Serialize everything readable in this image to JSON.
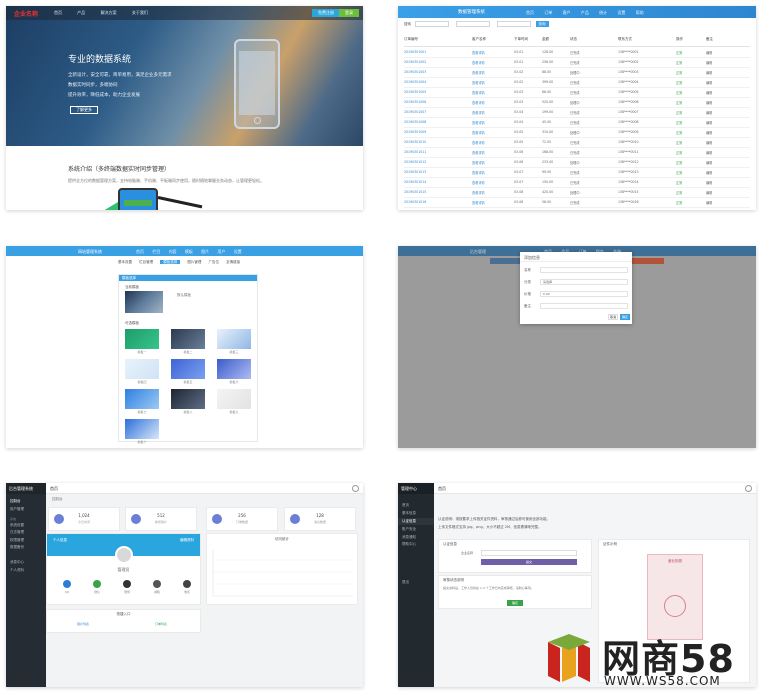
{
  "card1": {
    "logo": "企业名称",
    "menu": [
      "首页",
      "产品",
      "解决方案",
      "关于我们"
    ],
    "btn_register": "免费注册",
    "btn_login": "登录",
    "hero_title": "专业的数据系统",
    "hero_lines": [
      "全新设计，安全可靠，简单易用，满足企业多元需求",
      "数据实时同步，多端协同",
      "提升效率，降低成本，助力企业发展"
    ],
    "more_label": "了解更多",
    "section_title": "系统介绍（多终端数据实时同步管理）",
    "section_desc": "提供全方位的数据管理方案，支持电脑端、手机端、平板端同步使用，随时随地掌握业务动态，让管理更轻松。"
  },
  "card2": {
    "title": "数据管理系统",
    "menu": [
      "首页",
      "订单",
      "客户",
      "产品",
      "统计",
      "设置",
      "帮助"
    ],
    "filter_label": "搜索",
    "filter_btn": "查询",
    "headers": [
      "订单编号",
      "客户名称",
      "下单时间",
      "金额",
      "状态",
      "联系方式",
      "操作",
      "备注"
    ],
    "rows": [
      [
        "20190301001",
        "查看详情",
        "03-01",
        "128.00",
        "已完成",
        "138****0001",
        "正常",
        "编辑"
      ],
      [
        "20190301002",
        "查看详情",
        "03-01",
        "256.00",
        "已完成",
        "138****0002",
        "正常",
        "编辑"
      ],
      [
        "20190301003",
        "查看详情",
        "03-02",
        "88.00",
        "处理中",
        "138****0003",
        "正常",
        "编辑"
      ],
      [
        "20190301004",
        "查看详情",
        "03-02",
        "399.00",
        "已完成",
        "138****0004",
        "正常",
        "编辑"
      ],
      [
        "20190301005",
        "查看详情",
        "03-03",
        "66.00",
        "已完成",
        "138****0005",
        "正常",
        "编辑"
      ],
      [
        "20190301006",
        "查看详情",
        "03-03",
        "520.00",
        "处理中",
        "138****0006",
        "正常",
        "编辑"
      ],
      [
        "20190301007",
        "查看详情",
        "03-04",
        "199.00",
        "已完成",
        "138****0007",
        "正常",
        "编辑"
      ],
      [
        "20190301008",
        "查看详情",
        "03-04",
        "45.00",
        "已完成",
        "138****0008",
        "正常",
        "编辑"
      ],
      [
        "20190301009",
        "查看详情",
        "03-05",
        "310.00",
        "处理中",
        "138****0009",
        "正常",
        "编辑"
      ],
      [
        "20190301010",
        "查看详情",
        "03-05",
        "72.00",
        "已完成",
        "138****0010",
        "正常",
        "编辑"
      ],
      [
        "20190301011",
        "查看详情",
        "03-06",
        "168.00",
        "已完成",
        "138****0011",
        "正常",
        "编辑"
      ],
      [
        "20190301012",
        "查看详情",
        "03-06",
        "233.00",
        "处理中",
        "138****0012",
        "正常",
        "编辑"
      ],
      [
        "20190301013",
        "查看详情",
        "03-07",
        "99.00",
        "已完成",
        "138****0013",
        "正常",
        "编辑"
      ],
      [
        "20190301014",
        "查看详情",
        "03-07",
        "150.00",
        "已完成",
        "138****0014",
        "正常",
        "编辑"
      ],
      [
        "20190301015",
        "查看详情",
        "03-08",
        "420.00",
        "处理中",
        "138****0015",
        "正常",
        "编辑"
      ],
      [
        "20190301016",
        "查看详情",
        "03-08",
        "58.00",
        "已完成",
        "138****0016",
        "正常",
        "编辑"
      ]
    ]
  },
  "card3": {
    "title": "网站管理系统",
    "menu": [
      "首页",
      "栏目",
      "内容",
      "模板",
      "图片",
      "用户",
      "设置"
    ],
    "subtabs": [
      "基本设置",
      "栏目管理",
      "模板选择",
      "图片管理",
      "广告位",
      "友情链接"
    ],
    "active_subtab": "模板选择",
    "panel_title": "模板选择",
    "current_label": "当前模板",
    "current_name": "默认模板",
    "list_label": "可选模板",
    "thumb_labels": [
      "模板一",
      "模板二",
      "模板三",
      "模板四",
      "模板五",
      "模板六",
      "模板七",
      "模板八",
      "模板九",
      "模板十"
    ]
  },
  "card4": {
    "title": "后台管理",
    "menu": [
      "首页",
      "会员",
      "订单",
      "财务",
      "系统"
    ],
    "modal_title": "添加信息",
    "fields": [
      {
        "label": "名称",
        "value": ""
      },
      {
        "label": "分类",
        "value": "请选择"
      },
      {
        "label": "价格",
        "value": "0.00"
      },
      {
        "label": "备注",
        "value": ""
      }
    ],
    "cancel": "取消",
    "ok": "确定"
  },
  "card5": {
    "brand": "后台管理系统",
    "menu_a": [
      "控制台",
      "用户管理"
    ],
    "section": "系统",
    "menu_b": [
      "系统设置",
      "日志管理",
      "权限管理",
      "数据备份"
    ],
    "menu_c": [
      "消息中心",
      "个人资料"
    ],
    "topbar": "首页",
    "breadcrumb": "控制台",
    "stats": [
      {
        "value": "1,024",
        "label": "今日访问"
      },
      {
        "value": "512",
        "label": "新增用户"
      },
      {
        "value": "256",
        "label": "订单数量"
      },
      {
        "value": "128",
        "label": "消息数量"
      }
    ],
    "profile_left": "个人信息",
    "profile_right": "编辑资料",
    "profile_name": "管理员",
    "profile_icons": [
      "QQ",
      "微信",
      "微博",
      "邮箱",
      "电话"
    ],
    "chart_title": "访问统计",
    "bottom_title": "快捷入口",
    "bottom_items": [
      "用户列表",
      "订单列表"
    ],
    "icon_colors": [
      "#2e7cd6",
      "#3aa34a",
      "#333333",
      "#555555",
      "#444444"
    ]
  },
  "card6": {
    "brand": "管理中心",
    "menu": [
      "首页",
      "基本信息",
      "认证信息",
      "账户安全",
      "消息通知",
      "帮助中心",
      "退出"
    ],
    "topbar": "首页",
    "notice_lines": [
      "认证说明：请按要求上传相关证件资料，审核通过后即可使用全部功能。",
      "上传文件格式支持 jpg、png，大小不超过 2M，信息需清晰完整。"
    ],
    "form_title": "认证信息",
    "form_label": "企业名称",
    "form_btn": "提交",
    "check_title": "审核状态说明",
    "check_line": "提交资料后，工作人员将在 1-3 个工作日内完成审核，请耐心等待。",
    "check_btn": "确定",
    "right_title": "证件示例",
    "right_sub": "营业执照"
  },
  "watermark": {
    "brand": "网商58",
    "url": "WWW.WS58.COM"
  }
}
